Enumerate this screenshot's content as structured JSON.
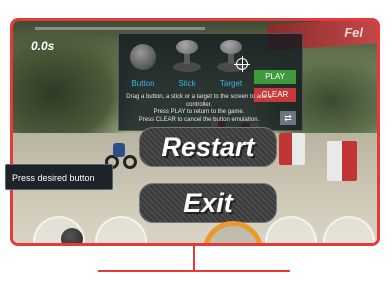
{
  "game": {
    "timer": "0.0s",
    "progress": 0.0,
    "banner_text": "Fel"
  },
  "controller_panel": {
    "items": [
      {
        "label": "Button",
        "icon": "button-icon"
      },
      {
        "label": "Stick",
        "icon": "stick-icon"
      },
      {
        "label": "Target",
        "icon": "target-icon"
      }
    ],
    "play_label": "PLAY",
    "clear_label": "CLEAR",
    "instructions": "Drag a button, a stick or a target to the screen to add a controller.\nPress PLAY to return to the game.\nPress CLEAR to cancel the button emulation."
  },
  "menu": {
    "restart_label": "Restart",
    "exit_label": "Exit"
  },
  "hint": "Press desired button",
  "colors": {
    "frame": "#e63a3a",
    "play": "#3f9a3a",
    "clear": "#c83a3a",
    "accent": "#3fb0e6",
    "dial": "#e99a2a"
  }
}
